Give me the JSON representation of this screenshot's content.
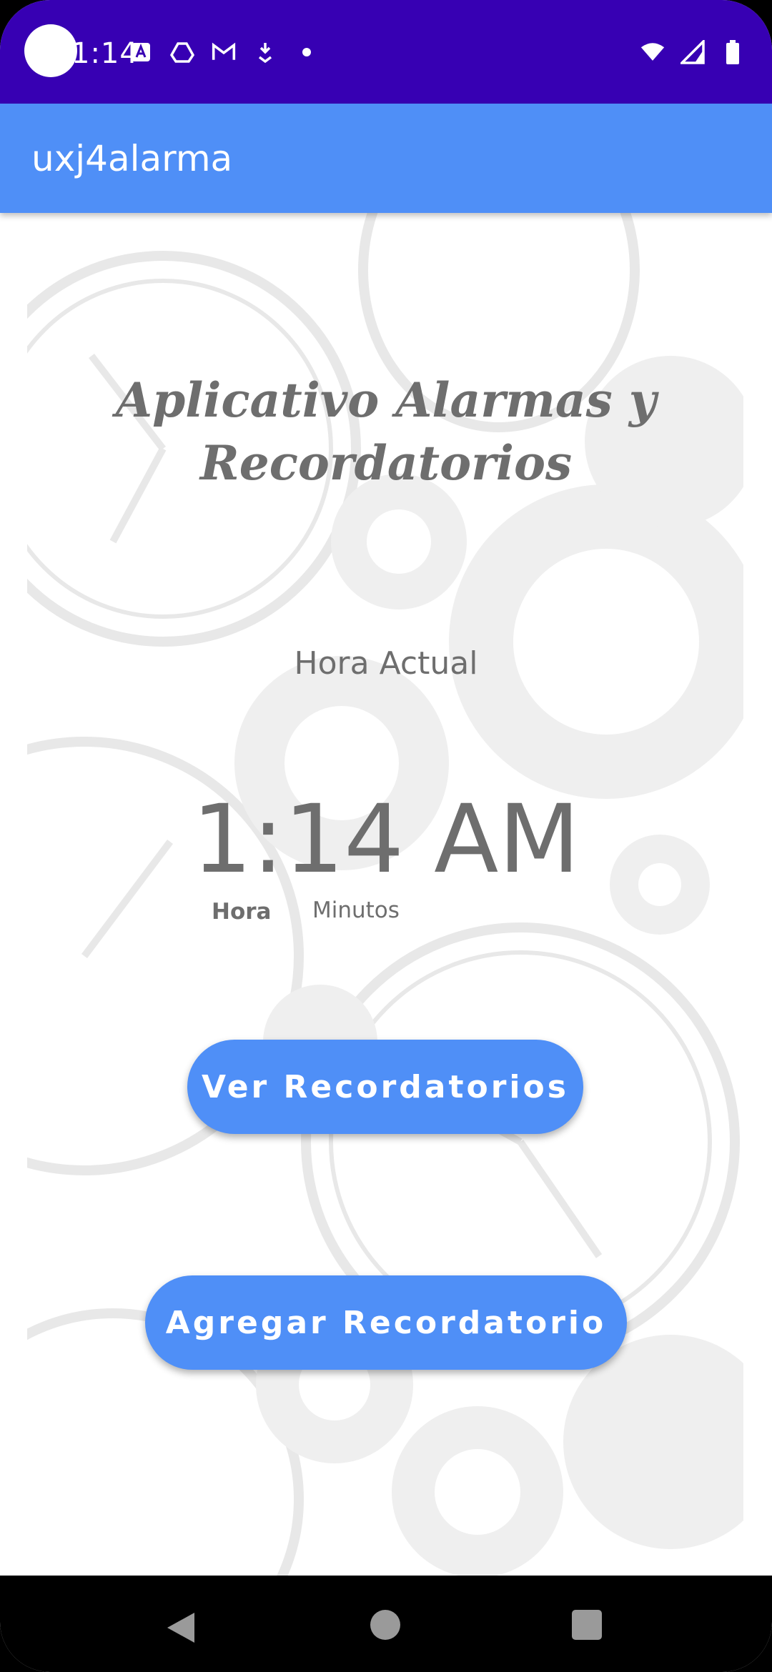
{
  "status_bar": {
    "time": "1:14",
    "left_icons": [
      "text-icon",
      "drive-icon",
      "gmail-icon",
      "download-icon",
      "dot-icon"
    ],
    "right_icons": [
      "wifi-icon",
      "signal-icon",
      "battery-icon"
    ]
  },
  "app_bar": {
    "title": "uxj4alarma"
  },
  "main": {
    "title": "Aplicativo Alarmas y Recordatorios",
    "current_time_label": "Hora Actual",
    "clock": "1:14 AM",
    "hour_label": "Hora",
    "minutes_label": "Minutos",
    "view_button": "Ver Recordatorios",
    "add_button": "Agregar Recordatorio"
  },
  "nav_bar": {
    "icons": [
      "back-icon",
      "home-icon",
      "recents-icon"
    ]
  },
  "colors": {
    "status_bar": "#3700b3",
    "accent": "#4f8ff7",
    "text_gray": "#6e6e6e"
  }
}
